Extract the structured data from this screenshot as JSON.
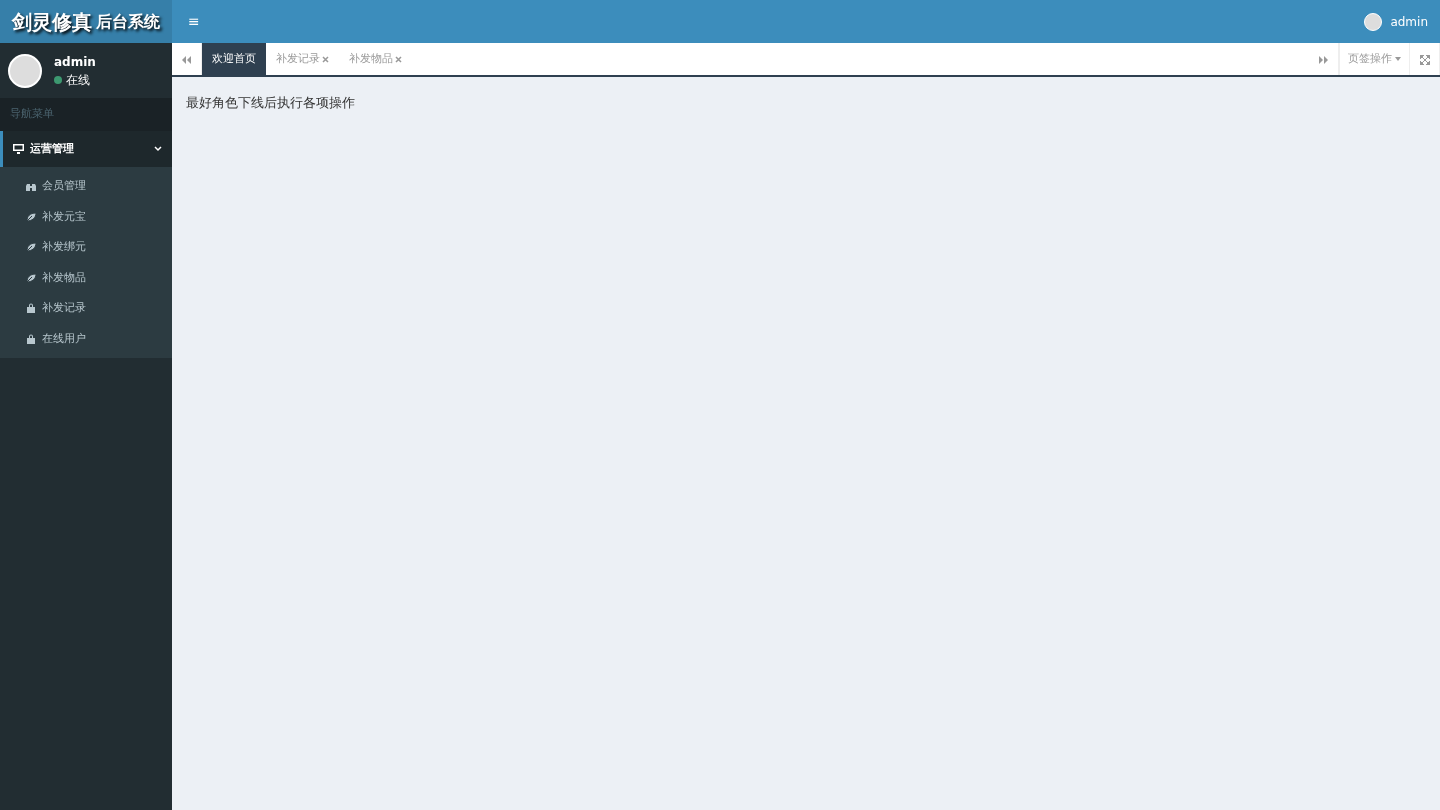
{
  "logo": {
    "main": "剑灵修真",
    "sub": "后台系统"
  },
  "header": {
    "menu_toggle": "≡",
    "user": "admin"
  },
  "user_panel": {
    "name": "admin",
    "status": "在线",
    "online": true
  },
  "nav_header": "导航菜单",
  "menu": {
    "label": "运营管理",
    "expanded": true,
    "children": [
      {
        "label": "会员管理",
        "kind": "binoculars"
      },
      {
        "label": "补发元宝",
        "kind": "leaf"
      },
      {
        "label": "补发绑元",
        "kind": "leaf"
      },
      {
        "label": "补发物品",
        "kind": "leaf"
      },
      {
        "label": "补发记录",
        "kind": "lock"
      },
      {
        "label": "在线用户",
        "kind": "lock"
      }
    ]
  },
  "tabs": [
    {
      "label": "欢迎首页",
      "selected": true,
      "closable": false
    },
    {
      "label": "补发记录",
      "selected": false,
      "closable": true
    },
    {
      "label": "补发物品",
      "selected": false,
      "closable": true
    }
  ],
  "tab_actions": {
    "dropdown": "页签操作"
  },
  "content": {
    "notice": "最好角色下线后执行各项操作"
  }
}
